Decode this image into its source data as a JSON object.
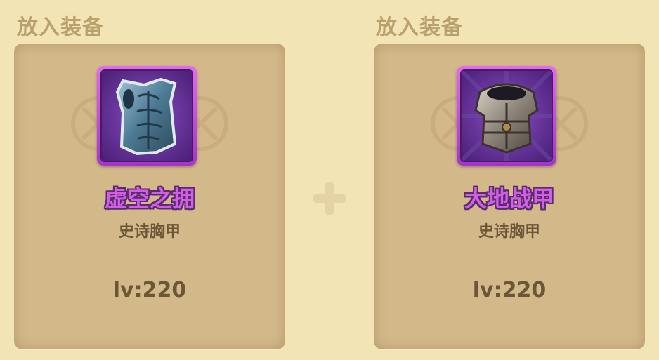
{
  "slots": [
    {
      "title": "放入装备",
      "item_name": "虚空之拥",
      "item_type": "史诗胸甲",
      "level": "lv:220",
      "icon": "blue-steel-chestplate-icon",
      "rarity_color": "#c94be0"
    },
    {
      "title": "放入装备",
      "item_name": "大地战甲",
      "item_type": "史诗胸甲",
      "level": "lv:220",
      "icon": "iron-plate-armor-icon",
      "rarity_color": "#c94be0"
    }
  ],
  "combine_icon": "plus-icon"
}
